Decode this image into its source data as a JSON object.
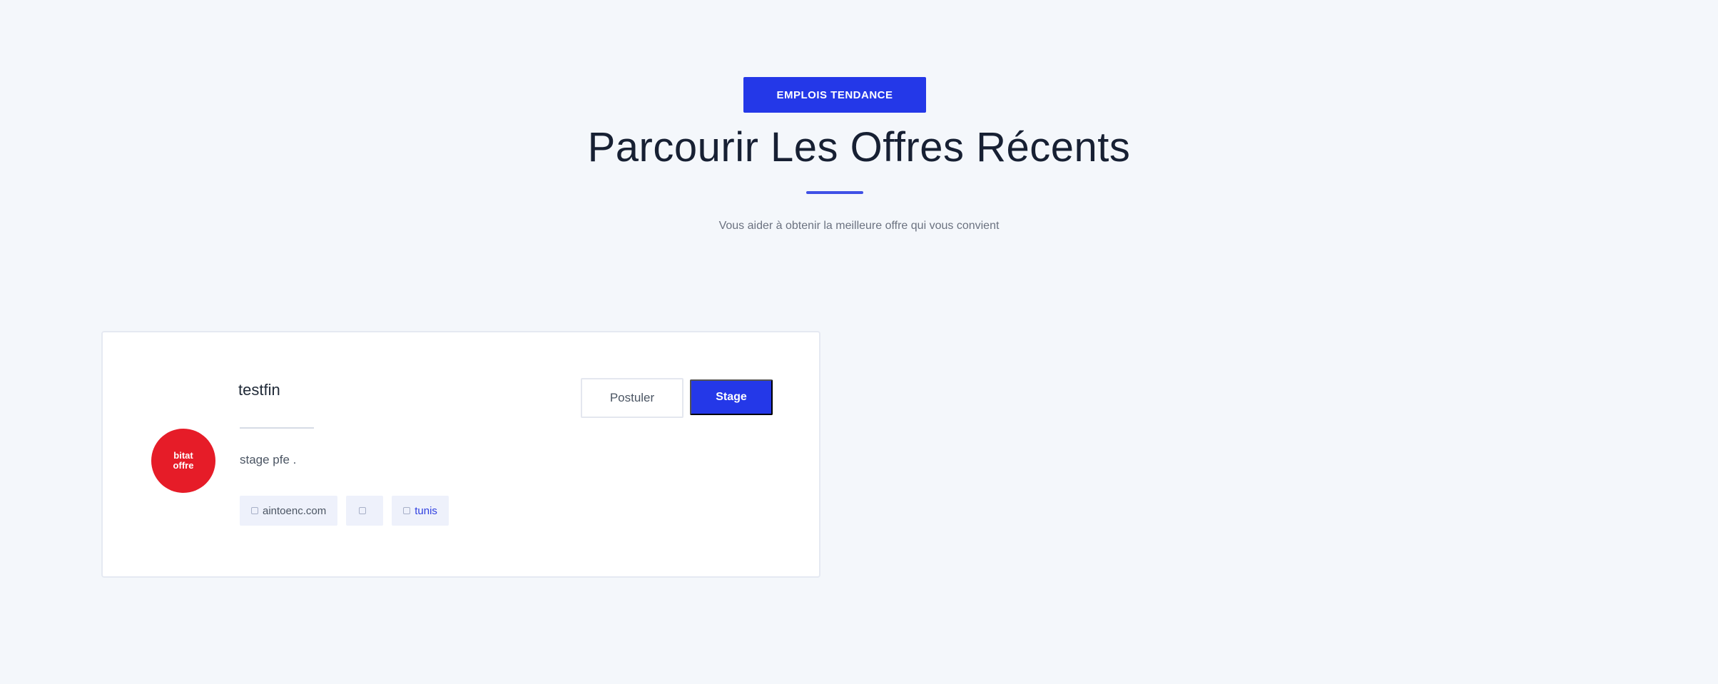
{
  "header": {
    "badge": "EMPLOIS TENDANCE",
    "title": "Parcourir Les Offres Récents",
    "subtitle": "Vous aider à obtenir la meilleure offre qui vous convient"
  },
  "job": {
    "title": "testfin",
    "description": "stage pfe .",
    "company_logo_text": "bitat\noffre",
    "tags": {
      "website": "aintoenc.com",
      "empty": "",
      "location": "tunis"
    },
    "apply_label": "Postuler",
    "type_label": "Stage"
  },
  "colors": {
    "accent": "#2438e8",
    "logo_bg": "#e61c28",
    "page_bg": "#f4f7fb"
  }
}
